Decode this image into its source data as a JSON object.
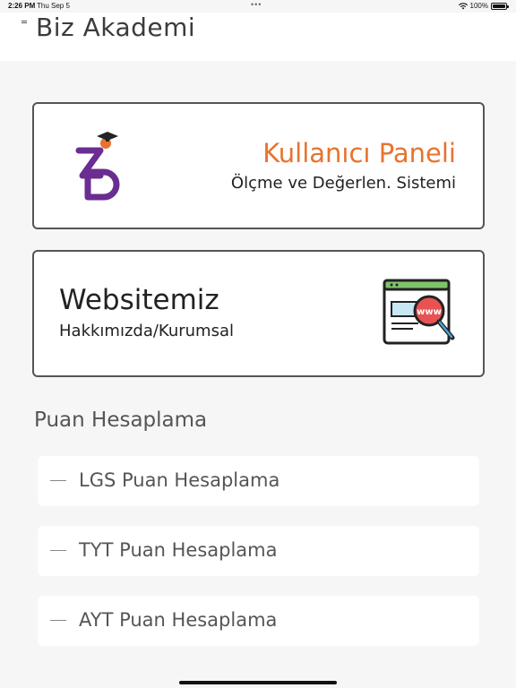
{
  "status": {
    "time": "2:26 PM",
    "date": "Thu Sep 5",
    "battery": "100%"
  },
  "header": {
    "title": "Biz Akademi"
  },
  "cards": {
    "panel": {
      "title": "Kullanıcı Paneli",
      "subtitle": "Ölçme ve Değerlen. Sistemi"
    },
    "website": {
      "title": "Websitemiz",
      "subtitle": "Hakkımızda/Kurumsal"
    }
  },
  "section": {
    "title": "Puan Hesaplama",
    "items": [
      {
        "label": "LGS Puan Hesaplama"
      },
      {
        "label": "TYT Puan Hesaplama"
      },
      {
        "label": "AYT Puan Hesaplama"
      }
    ]
  },
  "colors": {
    "accent": "#e8732d",
    "brand_purple": "#6b2d91"
  },
  "icons": {
    "menu": "menu-icon",
    "logo": "biz-logo",
    "www": "www-search-icon",
    "wifi": "wifi-icon",
    "battery": "battery-icon"
  }
}
